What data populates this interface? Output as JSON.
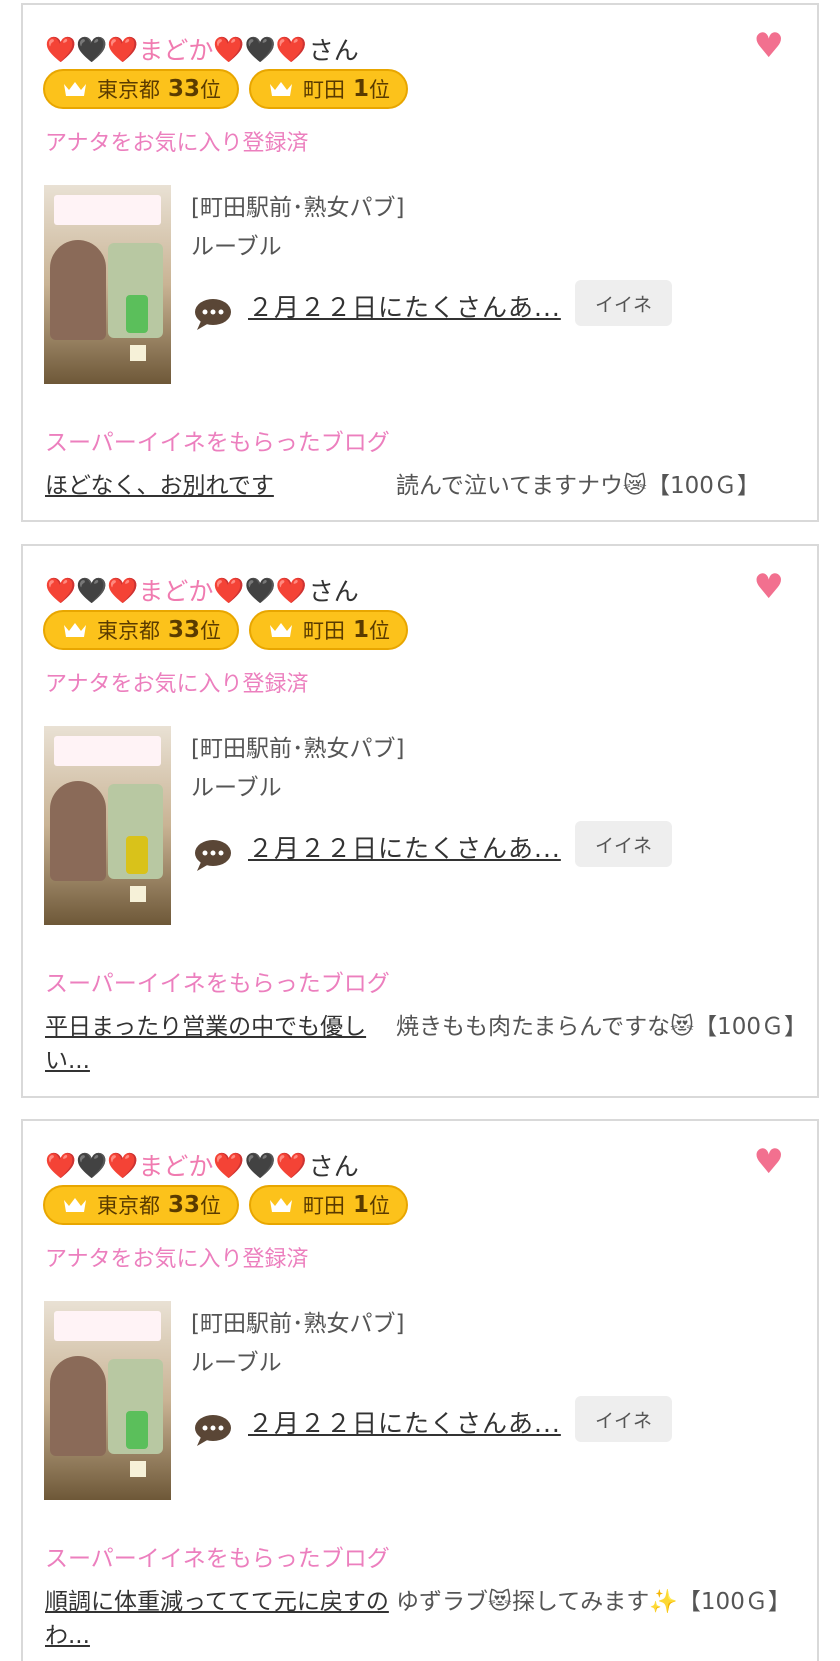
{
  "colors": {
    "pink": "#f07bb0",
    "heart": "#f2708f",
    "badge": "#fcc21b",
    "border": "#d9d9d9"
  },
  "cards": [
    {
      "name": {
        "prefix_emoji": "❤️🖤❤️",
        "text": "まどか",
        "suffix_emoji": "❤️🖤❤️",
        "honorific": "さん"
      },
      "favorite_icon": "heart-icon",
      "badges": [
        {
          "icon": "crown-icon",
          "area": "東京都",
          "rank": "33",
          "unit": "位"
        },
        {
          "icon": "crown-icon",
          "area": "町田",
          "rank": "1",
          "unit": "位"
        }
      ],
      "fav_status": "アナタをお気に入り登録済",
      "shop_area": "[町田駅前･熟女パブ]",
      "shop_name": "ルーブル",
      "blog_link": "２月２２日にたくさんあ...",
      "iine_label": "イイネ",
      "super_label": "スーパーイイネをもらったブログ",
      "super_blog_title": "ほどなく、お別れです",
      "super_comment": "読んで泣いてますナウ😿【100Ｇ】"
    },
    {
      "name": {
        "prefix_emoji": "❤️🖤❤️",
        "text": "まどか",
        "suffix_emoji": "❤️🖤❤️",
        "honorific": "さん"
      },
      "favorite_icon": "heart-icon",
      "badges": [
        {
          "icon": "crown-icon",
          "area": "東京都",
          "rank": "33",
          "unit": "位"
        },
        {
          "icon": "crown-icon",
          "area": "町田",
          "rank": "1",
          "unit": "位"
        }
      ],
      "fav_status": "アナタをお気に入り登録済",
      "shop_area": "[町田駅前･熟女パブ]",
      "shop_name": "ルーブル",
      "blog_link": "２月２２日にたくさんあ...",
      "iine_label": "イイネ",
      "super_label": "スーパーイイネをもらったブログ",
      "super_blog_title": "平日まったり営業の中でも優しい...",
      "super_comment": "焼きもも肉たまらんですな😻【100Ｇ】"
    },
    {
      "name": {
        "prefix_emoji": "❤️🖤❤️",
        "text": "まどか",
        "suffix_emoji": "❤️🖤❤️",
        "honorific": "さん"
      },
      "favorite_icon": "heart-icon",
      "badges": [
        {
          "icon": "crown-icon",
          "area": "東京都",
          "rank": "33",
          "unit": "位"
        },
        {
          "icon": "crown-icon",
          "area": "町田",
          "rank": "1",
          "unit": "位"
        }
      ],
      "fav_status": "アナタをお気に入り登録済",
      "shop_area": "[町田駅前･熟女パブ]",
      "shop_name": "ルーブル",
      "blog_link": "２月２２日にたくさんあ...",
      "iine_label": "イイネ",
      "super_label": "スーパーイイネをもらったブログ",
      "super_blog_title": "順調に体重減っててて元に戻すのわ...",
      "super_comment": "ゆずラブ😻探してみます✨【100Ｇ】"
    }
  ]
}
